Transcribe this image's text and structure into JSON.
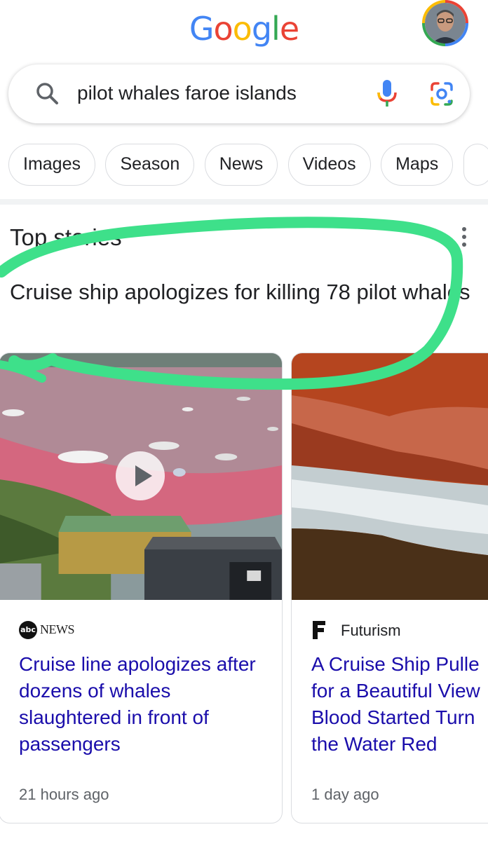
{
  "logo": {
    "letters": [
      "G",
      "o",
      "o",
      "g",
      "l",
      "e"
    ],
    "colors": [
      "#4285f4",
      "#ea4335",
      "#fbbc05",
      "#4285f4",
      "#34a853",
      "#ea4335"
    ]
  },
  "search": {
    "query": "pilot whales faroe islands"
  },
  "chips": [
    "Images",
    "Season",
    "News",
    "Videos",
    "Maps"
  ],
  "top_stories": {
    "heading": "Top stories",
    "headline": "Cruise ship apologizes for killing 78 pilot whales"
  },
  "cards": [
    {
      "source": "NEWS",
      "source_logo": "abc",
      "title": "Cruise line apologizes after dozens of whales slaughtered in front of passengers",
      "time": "21 hours ago"
    },
    {
      "source": "Futurism",
      "source_logo": "F",
      "title_lines": [
        "A Cruise Ship Pulle",
        "for a Beautiful View",
        "Blood Started Turn",
        "the Water Red"
      ],
      "time": "1 day ago"
    }
  ],
  "colors": {
    "link": "#1a0dab",
    "highlight": "#3ee08a"
  }
}
